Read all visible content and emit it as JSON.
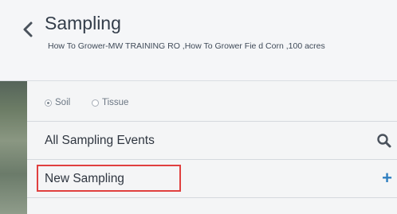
{
  "header": {
    "title": "Sampling",
    "subtitle": "How To Grower-MW TRAINING RO ,How To Grower Fie d Corn ,100 acres"
  },
  "sample_type": {
    "options": [
      "Soil",
      "Tissue"
    ],
    "selected": "Soil"
  },
  "menu": {
    "all_events_label": "All Sampling Events",
    "new_sampling_label": "New Sampling",
    "add_symbol": "+"
  },
  "colors": {
    "highlight": "#e0403f",
    "accent": "#2f7fc0"
  },
  "icons": {
    "back": "chevron-left-icon",
    "search": "search-icon",
    "add": "plus-icon"
  }
}
